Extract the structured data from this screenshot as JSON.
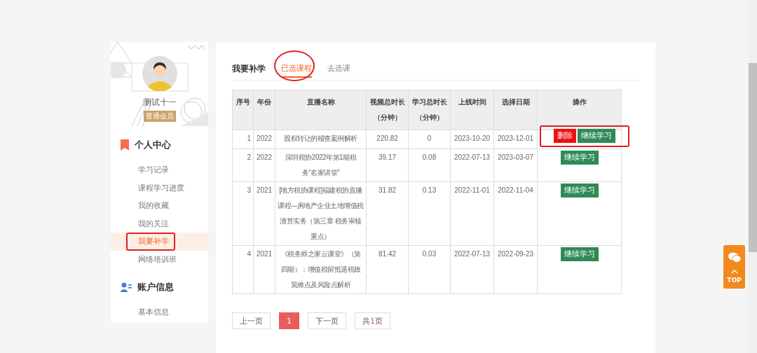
{
  "sidebar": {
    "user": {
      "name": "测试十一",
      "badge": "普通会员"
    },
    "sections": [
      {
        "title": "个人中心",
        "kind": "personal",
        "items": [
          {
            "label": "学习记录",
            "selected": false,
            "highlighted": false
          },
          {
            "label": "课程学习进度",
            "selected": false,
            "highlighted": false
          },
          {
            "label": "我的收藏",
            "selected": false,
            "highlighted": false
          },
          {
            "label": "我的关注",
            "selected": false,
            "highlighted": false
          },
          {
            "label": "我要补学",
            "selected": true,
            "highlighted": true
          },
          {
            "label": "网络培训班",
            "selected": false,
            "highlighted": false
          }
        ]
      },
      {
        "title": "账户信息",
        "kind": "account",
        "items": [
          {
            "label": "基本信息",
            "selected": false,
            "highlighted": false
          }
        ]
      }
    ]
  },
  "main": {
    "title": "我要补学",
    "tabs": [
      {
        "label": "已选课程",
        "selected": true,
        "highlighted": true
      },
      {
        "label": "去选课",
        "selected": false,
        "highlighted": false
      }
    ],
    "table": {
      "columns": [
        {
          "label": "序号"
        },
        {
          "label": "年份"
        },
        {
          "label": "直播名称"
        },
        {
          "label": "视频总时长",
          "unit": "（分钟）"
        },
        {
          "label": "学习总时长",
          "unit": "（分钟）"
        },
        {
          "label": "上线时间"
        },
        {
          "label": "选择日期"
        },
        {
          "label": "操作"
        }
      ],
      "rows": [
        {
          "cells": [
            "1",
            "2022",
            "股权转让的稽查案例解析",
            "220.82",
            "0",
            "2023-10-20",
            "2023-12-01"
          ],
          "actions": [
            {
              "label": "删除",
              "kind": "delete"
            },
            {
              "label": "继续学习",
              "kind": "continue"
            }
          ],
          "highlighted": true
        },
        {
          "cells": [
            "2",
            "2022",
            "深圳税协2022年第1期税务“名家讲堂”",
            "39.17",
            "0.08",
            "2022-07-13",
            "2023-03-07"
          ],
          "actions": [
            {
              "label": "继续学习",
              "kind": "continue"
            }
          ],
          "highlighted": false
        },
        {
          "cells": [
            "3",
            "2021",
            "[地方税协课程]福建税协直播课程---房地产企业土地增值税清算实务（第三章 税务审核重点）",
            "31.82",
            "0.13",
            "2022-11-01",
            "2022-11-04"
          ],
          "actions": [
            {
              "label": "继续学习",
              "kind": "continue"
            }
          ],
          "highlighted": false
        },
        {
          "cells": [
            "4",
            "2021",
            "《税务师之家云课堂》（第四期）：增值税留抵退税政策难点及风险点解析",
            "81.42",
            "0.03",
            "2022-07-13",
            "2022-09-23"
          ],
          "actions": [
            {
              "label": "继续学习",
              "kind": "continue"
            }
          ],
          "highlighted": false
        }
      ]
    },
    "pagination": {
      "prev": "上一页",
      "pages": [
        {
          "label": "1",
          "selected": true
        }
      ],
      "next": "下一页",
      "total_prefix": "共",
      "total_count": "1",
      "total_suffix": "页"
    }
  },
  "float_button": {
    "label": "TOP"
  }
}
